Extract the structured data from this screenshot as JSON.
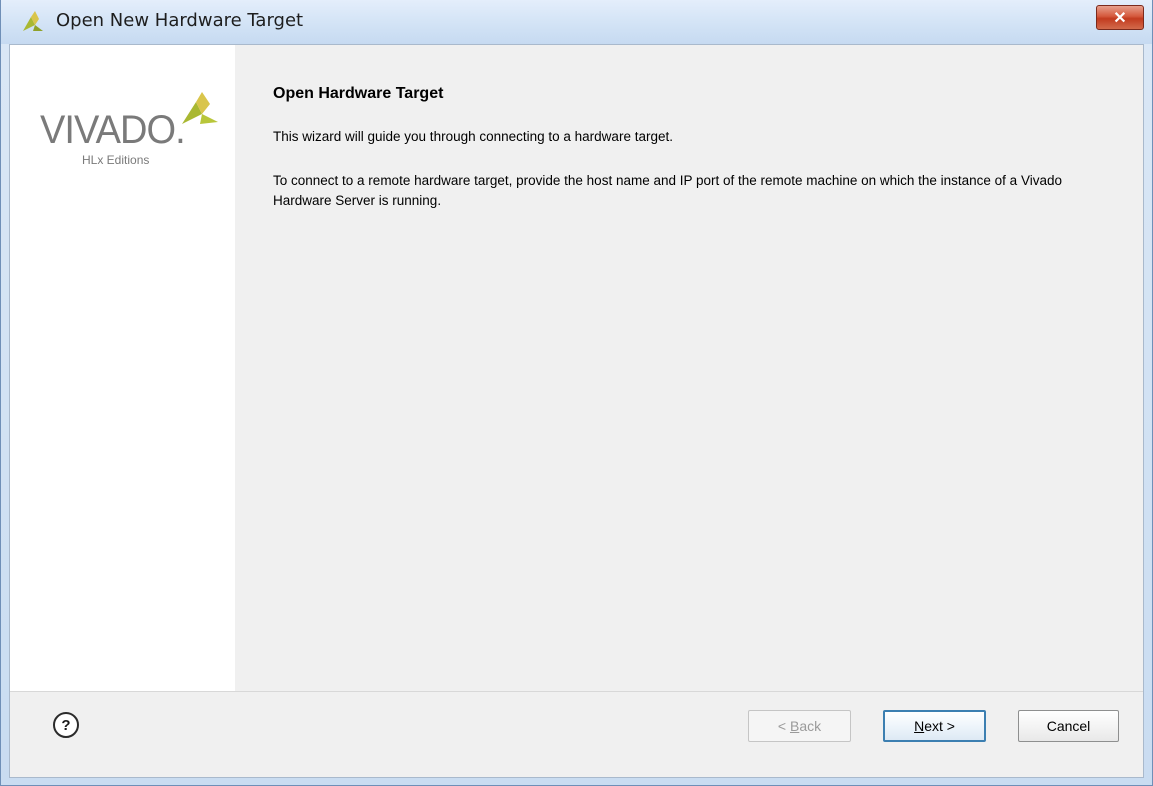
{
  "window": {
    "title": "Open New Hardware Target",
    "close_label": "✕"
  },
  "logo": {
    "word": "VIVADO.",
    "sub": "HLx Editions"
  },
  "page": {
    "title": "Open Hardware Target",
    "para1": "This wizard will guide you through connecting to a hardware target.",
    "para2": "To connect to a remote hardware target, provide the host name and IP port of the remote machine on which the instance of a Vivado Hardware Server is running."
  },
  "footer": {
    "help_label": "?",
    "back_prefix": "< ",
    "back_mnemonic": "B",
    "back_rest": "ack",
    "next_mnemonic": "N",
    "next_rest": "ext >",
    "cancel_label": "Cancel"
  },
  "colors": {
    "accent_green": "#a9b832",
    "accent_yellow": "#d9c54b",
    "close_red": "#c23b1f",
    "focus_blue": "#3c7fb1"
  },
  "icons": {
    "title_icon": "vivado-mark-icon",
    "close_icon": "close-icon",
    "help_icon": "help-icon"
  }
}
